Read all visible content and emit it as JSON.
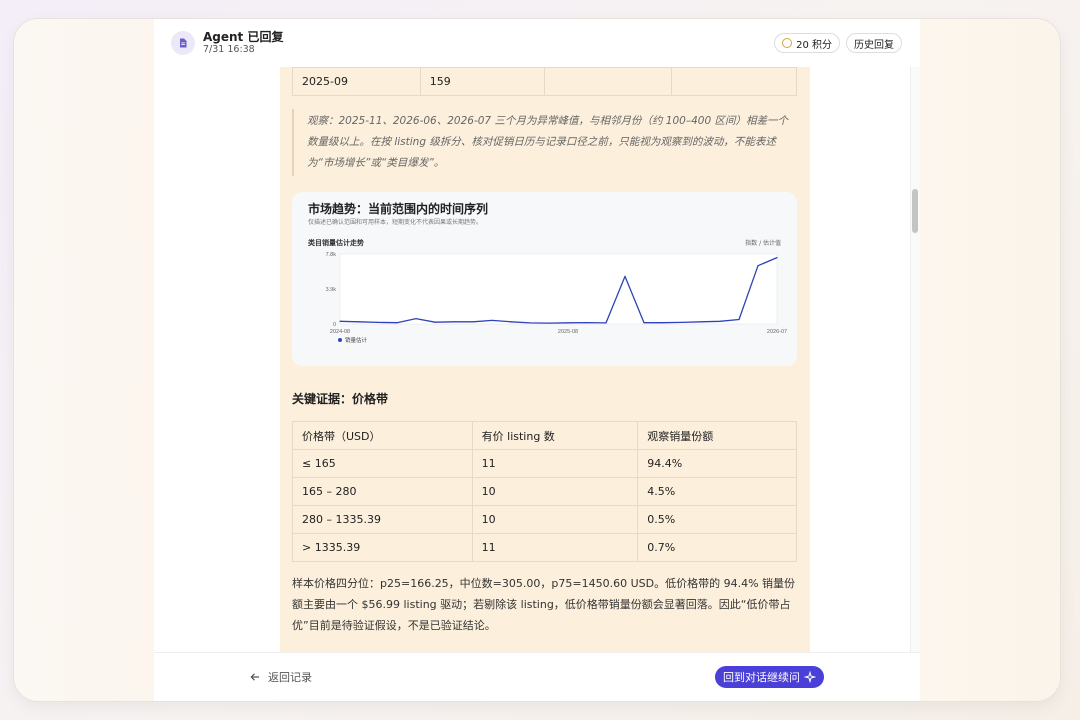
{
  "header": {
    "title": "Agent 已回复",
    "time": "7/31 16:38",
    "points": "20 积分",
    "history": "历史回复"
  },
  "top_table": {
    "rows": [
      [
        "2025-09",
        "159",
        "",
        ""
      ]
    ]
  },
  "observation": "观察：2025-11、2026-06、2026-07 三个月为异常峰值，与相邻月份（约 100–400 区间）相差一个数量级以上。在按 listing 级拆分、核对促销日历与记录口径之前，只能视为观察到的波动，不能表述为“市场增长”或“类目爆发”。",
  "chart_card": {
    "title": "市场趋势：当前范围内的时间序列",
    "subtitle": "仅描述已确认范围和可用样本，短期变化不代表因果或长期趋势。",
    "chart_name": "类目销量估计走势",
    "unit": "指数 / 估计值"
  },
  "chart_data": {
    "type": "line",
    "x": [
      "2024-08",
      "2024-09",
      "2024-10",
      "2024-11",
      "2024-12",
      "2025-01",
      "2025-02",
      "2025-03",
      "2025-04",
      "2025-05",
      "2025-06",
      "2025-07",
      "2025-08",
      "2025-09",
      "2025-10",
      "2025-11",
      "2025-12",
      "2026-01",
      "2026-02",
      "2026-03",
      "2026-04",
      "2026-05",
      "2026-06",
      "2026-07"
    ],
    "series": [
      {
        "name": "销量估计",
        "values": [
          300,
          250,
          180,
          150,
          600,
          200,
          250,
          240,
          400,
          250,
          120,
          100,
          130,
          159,
          120,
          5300,
          150,
          140,
          180,
          250,
          300,
          500,
          6500,
          7400
        ],
        "color": "#2f43b8"
      }
    ],
    "ylim": [
      0,
      7800
    ],
    "y_ticks": [
      "7.8k",
      "3.9k",
      "0"
    ],
    "x_ticks": [
      "2024-08",
      "2025-08",
      "2026-07"
    ],
    "legend": "bottom-left",
    "grid": false
  },
  "section_title": "关键证据：价格带",
  "price_table": {
    "headers": [
      "价格带（USD）",
      "有价 listing 数",
      "观察销量份额"
    ],
    "rows": [
      [
        "≤ 165",
        "11",
        "94.4%"
      ],
      [
        "165 – 280",
        "10",
        "4.5%"
      ],
      [
        "280 – 1335.39",
        "10",
        "0.5%"
      ],
      [
        "> 1335.39",
        "11",
        "0.7%"
      ]
    ]
  },
  "summary": "样本价格四分位：p25=166.25，中位数=305.00，p75=1450.60 USD。低价格带的 94.4% 销量份额主要由一个 $56.99 listing 驱动；若剔除该 listing，低价格带销量份额会显著回落。因此“低价带占优”目前是待验证假设，不是已验证结论。",
  "footer": {
    "back_label": "返回记录",
    "cta_label": "回到对话继续问"
  },
  "colors": {
    "accent": "#4a3fd6",
    "content_bg": "#fcefdc",
    "line": "#2f43b8"
  }
}
